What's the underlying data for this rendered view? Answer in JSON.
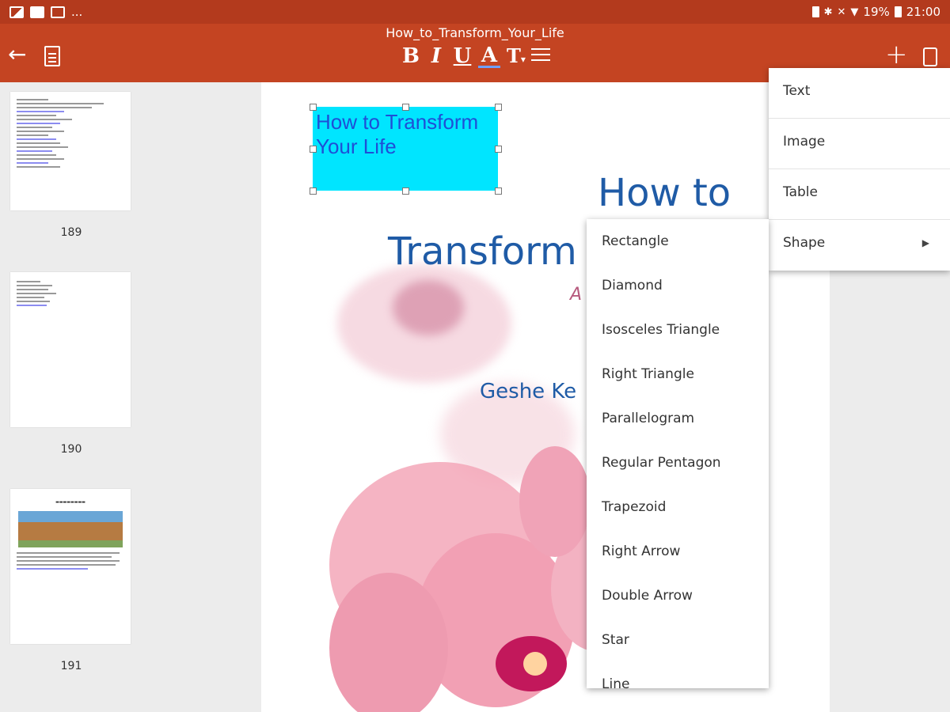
{
  "status_bar": {
    "time": "21:00",
    "battery": "19%",
    "overflow": "..."
  },
  "app_bar": {
    "title": "How_to_Transform_Your_Life",
    "format": {
      "bold": "B",
      "italic": "I",
      "underline": "U",
      "font_color": "A",
      "text_size": "T",
      "align": ""
    }
  },
  "thumbnails": [
    {
      "page": "189"
    },
    {
      "page": "190"
    },
    {
      "page": "191"
    }
  ],
  "page": {
    "textbox_text": "How to Transform Your Life",
    "cover_line_1": "How to",
    "cover_line_2": "Transform Y",
    "cover_line_3": "A",
    "cover_line_4": "Geshe  Ke"
  },
  "insert_menu": {
    "items": [
      "Text",
      "Image",
      "Table",
      "Shape"
    ]
  },
  "shape_menu": {
    "items": [
      "Rectangle",
      "Diamond",
      "Isosceles Triangle",
      "Right Triangle",
      "Parallelogram",
      "Regular Pentagon",
      "Trapezoid",
      "Right Arrow",
      "Double Arrow",
      "Star",
      "Line"
    ]
  },
  "colors": {
    "status_bar": "#b33a1d",
    "app_bar": "#c44422",
    "textbox_fill": "#00e5ff",
    "textbox_text": "#1f4fd6",
    "cover_text": "#1f5ba6"
  }
}
